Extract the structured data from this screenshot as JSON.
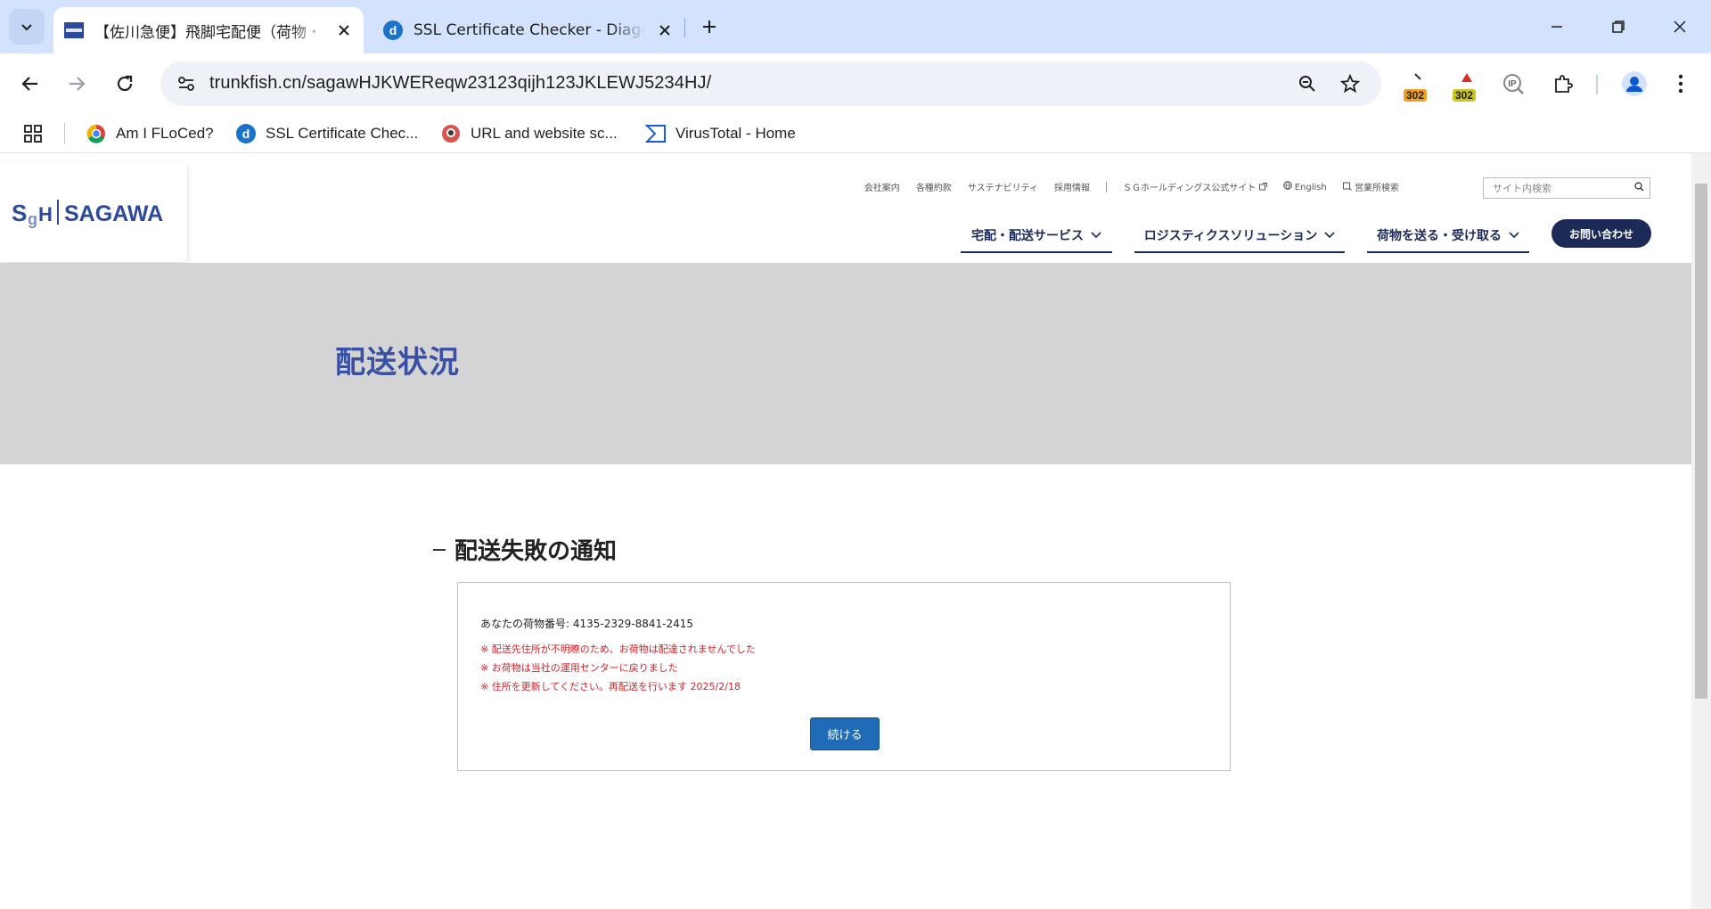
{
  "browser": {
    "tabs": [
      {
        "title": "【佐川急便】飛脚宅配便（荷物・S",
        "favicon": "sagawa-favicon",
        "active": true
      },
      {
        "title": "SSL Certificate Checker - Diagno",
        "favicon": "d",
        "active": false
      }
    ],
    "url": "trunkfish.cn/sagawHJKWEReqw23123qijh123JKLEWJ5234HJ/",
    "extensions": [
      {
        "name": "redirect-extension-icon",
        "badge": "302",
        "badge_color": "#f0a020"
      },
      {
        "name": "alert-extension-icon",
        "badge": "302",
        "badge_color": "#c8c821"
      },
      {
        "name": "ip-extension-icon",
        "badge": ""
      }
    ],
    "bookmarks": [
      {
        "label": "Am I FLoCed?"
      },
      {
        "label": "SSL Certificate Chec..."
      },
      {
        "label": "URL and website sc..."
      },
      {
        "label": "VirusTotal - Home"
      }
    ]
  },
  "site": {
    "logo_text": "SAGAWA",
    "logo_mark": "SgH",
    "util_links": [
      "会社案内",
      "各種約款",
      "サステナビリティ",
      "採用情報",
      "ＳＧホールディングス公式サイト",
      "English",
      "営業所検索"
    ],
    "search_placeholder": "サイト内検索",
    "nav": [
      "宅配・配送サービス",
      "ロジスティクスソリューション",
      "荷物を送る・受け取る"
    ],
    "contact": "お問い合わせ",
    "hero_title": "配送状況",
    "notice_title": "配送失敗の通知",
    "package_line": "あなたの荷物番号: 4135-2329-8841-2415",
    "warnings": [
      "※ 配送先住所が不明瞭のため、お荷物は配達されませんでした",
      "※ お荷物は当社の運用センターに戻りました",
      "※ 住所を更新してください。再配送を行います 2025/2/18"
    ],
    "continue_label": "続ける",
    "colors": {
      "brand": "#1c2a57",
      "hero_title": "#3a50a4",
      "warning": "#d0242a",
      "button": "#1f6bb5"
    }
  }
}
